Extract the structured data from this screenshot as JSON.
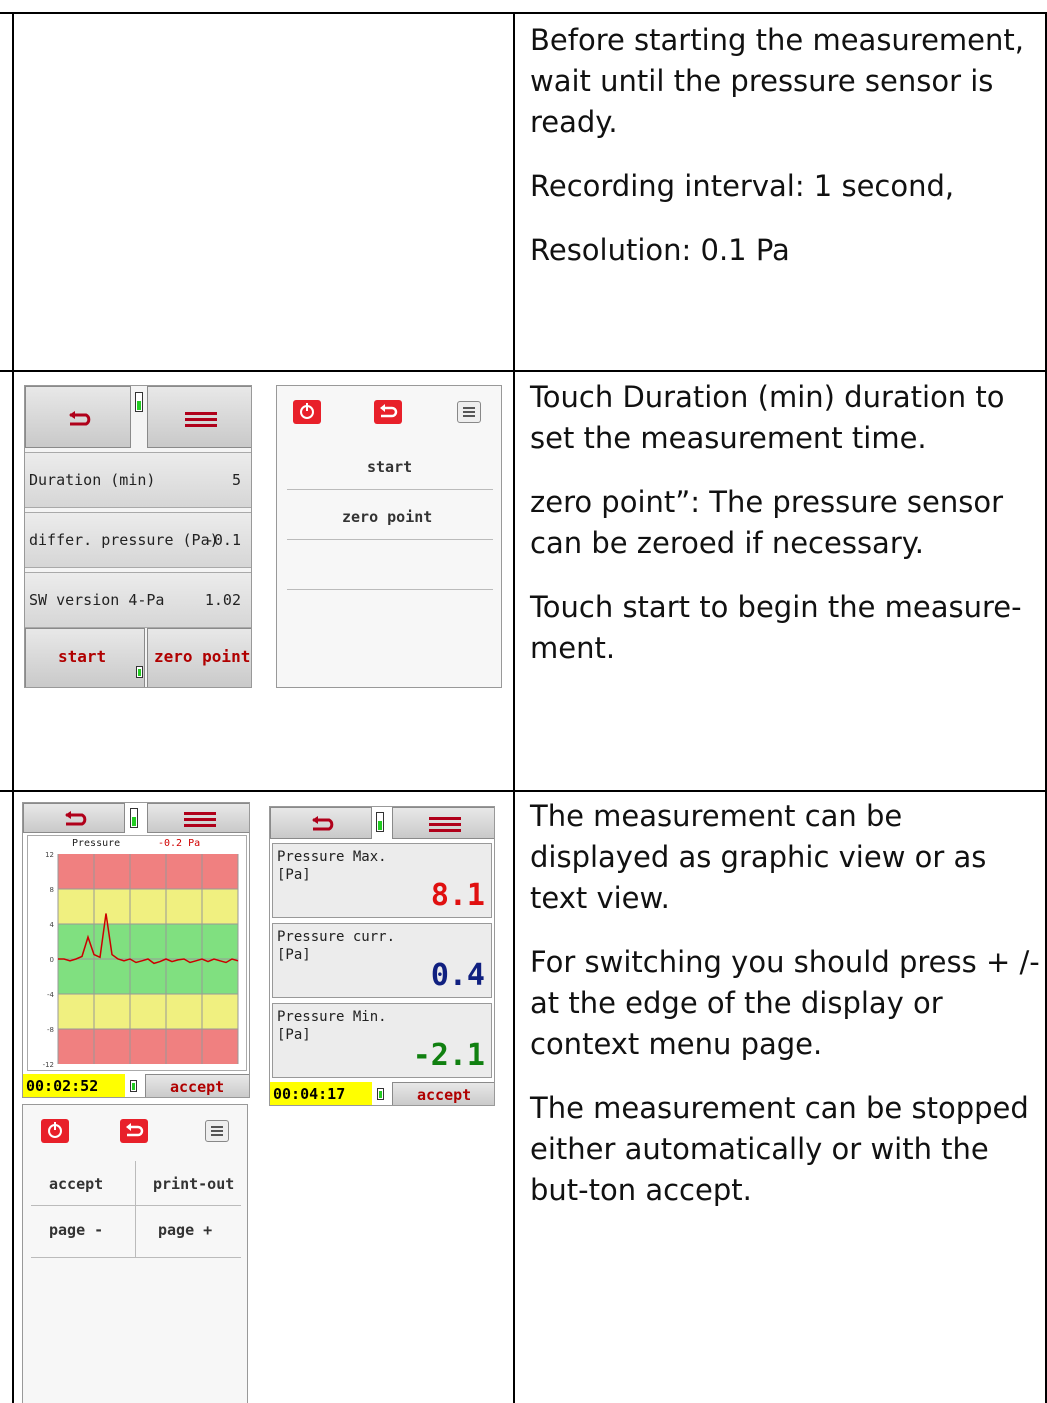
{
  "rows": [
    {
      "paragraphs": [
        "Before starting the measurement, wait until the pressure sensor is ready.",
        "Recording interval: 1 second,",
        "Resolution: 0.1 Pa"
      ]
    },
    {
      "paragraphs": [
        "Touch Duration (min) duration to set the measurement time.",
        "zero point”: The pressure sensor can be zeroed if necessary.",
        "Touch start to begin the measure-ment."
      ]
    },
    {
      "paragraphs": [
        "The measurement can be displayed as graphic view or as text view.",
        "For switching you should press + /- at the edge of the display or context menu page.",
        "The measurement can be stopped either automatically or with the but-ton accept."
      ]
    }
  ],
  "screen_settings": {
    "rows": [
      {
        "label": "Duration (min)",
        "value": "5"
      },
      {
        "label": "differ. pressure (Pa)",
        "value": "-0.1"
      },
      {
        "label": "SW version 4-Pa",
        "value": "1.02"
      }
    ],
    "start_label": "start",
    "zero_label": "zero point"
  },
  "screen_context1": {
    "items": [
      "start",
      "zero point"
    ]
  },
  "screen_graph": {
    "title": "Pressure",
    "current": "-0.2 Pa",
    "time": "00:02:52",
    "accept_label": "accept",
    "colors": {
      "red_zone": "#f08080",
      "yellow_zone": "#f0f080",
      "green_zone": "#80e080",
      "trace": "#cc0000"
    }
  },
  "chart_data": {
    "type": "line",
    "title": "Pressure",
    "ylim": [
      -12,
      12
    ],
    "yticks": [
      "12",
      "8",
      "4",
      "0",
      "-4",
      "-8",
      "-12"
    ],
    "xlabel": "",
    "ylabel": "",
    "grid": true,
    "series": [
      {
        "name": "",
        "x": [
          0,
          1,
          2,
          3,
          4,
          5,
          6,
          7,
          8,
          9,
          10,
          11,
          12,
          13,
          14,
          15,
          16,
          17,
          18,
          19,
          20,
          21,
          22,
          23,
          24,
          25,
          26,
          27,
          28,
          29,
          30
        ],
        "values": [
          0,
          0,
          -0.2,
          0,
          0.3,
          2.5,
          0.5,
          0.2,
          5.2,
          0.5,
          0,
          -0.2,
          0,
          -0.4,
          -0.2,
          0,
          -0.5,
          -0.3,
          0,
          -0.3,
          -0.1,
          0,
          -0.4,
          -0.2,
          0,
          -0.3,
          0,
          -0.2,
          -0.4,
          0,
          -0.2
        ]
      }
    ]
  },
  "screen_text": {
    "items": [
      {
        "label": "Pressure Max.\n[Pa]",
        "value": "8.1",
        "color": "#e01010"
      },
      {
        "label": "Pressure curr.\n[Pa]",
        "value": "0.4",
        "color": "#102080"
      },
      {
        "label": "Pressure Min.\n[Pa]",
        "value": "-2.1",
        "color": "#108010"
      }
    ],
    "time": "00:04:17",
    "accept_label": "accept"
  },
  "screen_context2": {
    "items": [
      "accept",
      "print-out",
      "page -",
      "page +"
    ]
  }
}
